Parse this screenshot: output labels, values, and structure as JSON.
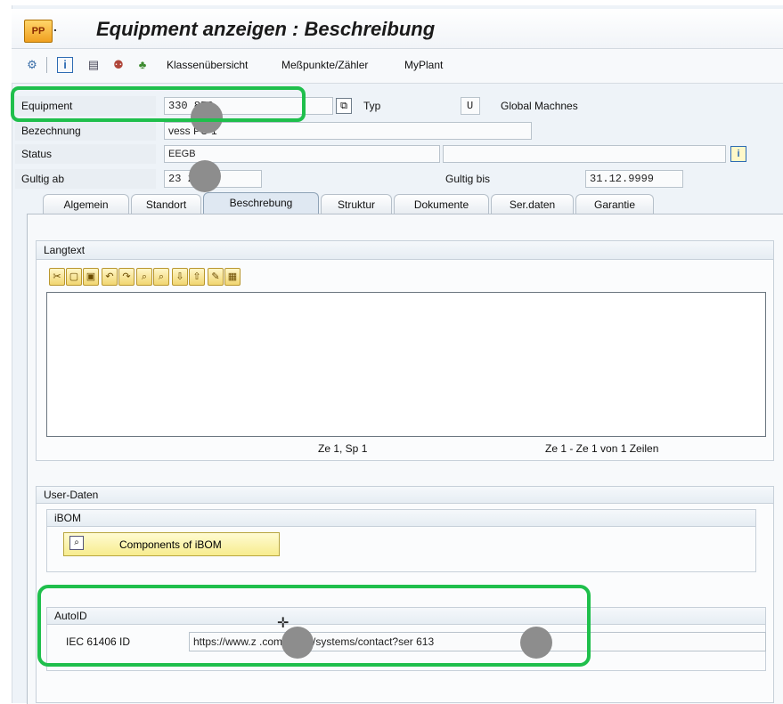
{
  "window": {
    "app_icon_text": "PP",
    "title": "Equipment anzeigen : Beschreibung"
  },
  "toolbar": {
    "buttons": [
      "Klassenübersicht",
      "Meßpunkte/Zähler",
      "MyPlant"
    ],
    "icons": [
      "display-change-icon",
      "info-icon",
      "document-icon",
      "partners-icon",
      "hierarchy-icon"
    ]
  },
  "header": {
    "equipment_label": "Equipment",
    "equipment_value": "330  853",
    "typ_label": "Typ",
    "typ_value": "U",
    "typ_description": "Global Machnes",
    "bezeichnung_label": "Bezechnung",
    "bezeichnung_value": "vess  PU 1",
    "status_label": "Status",
    "status_value": "EEGB",
    "gueltig_ab_label": "Gultig ab",
    "gueltig_ab_value": "23      2022",
    "gueltig_bis_label": "Gultig bis",
    "gueltig_bis_value": "31.12.9999"
  },
  "tabs": [
    {
      "label": "Algemein"
    },
    {
      "label": "Standort"
    },
    {
      "label": "Beschrebung"
    },
    {
      "label": "Struktur"
    },
    {
      "label": "Dokumente"
    },
    {
      "label": "Ser.daten"
    },
    {
      "label": "Garantie"
    }
  ],
  "active_tab": "Beschrebung",
  "langtext": {
    "title": "Langtext",
    "cursor_position": "Ze 1, Sp 1",
    "line_info": "Ze 1 - Ze 1 von 1 Zeilen"
  },
  "userdaten": {
    "title": "User-Daten",
    "ibom": {
      "title": "iBOM",
      "button_label": "Components of iBOM"
    },
    "autoid": {
      "title": "AutoID",
      "field_label": "IEC 61406 ID",
      "field_value": "https://www.z       .com/de-en/systems/contact?ser        613"
    }
  },
  "colors": {
    "highlight": "#1fbf4c",
    "redaction": "#8d8d8d",
    "button_yellow": "#f7ec8e"
  }
}
